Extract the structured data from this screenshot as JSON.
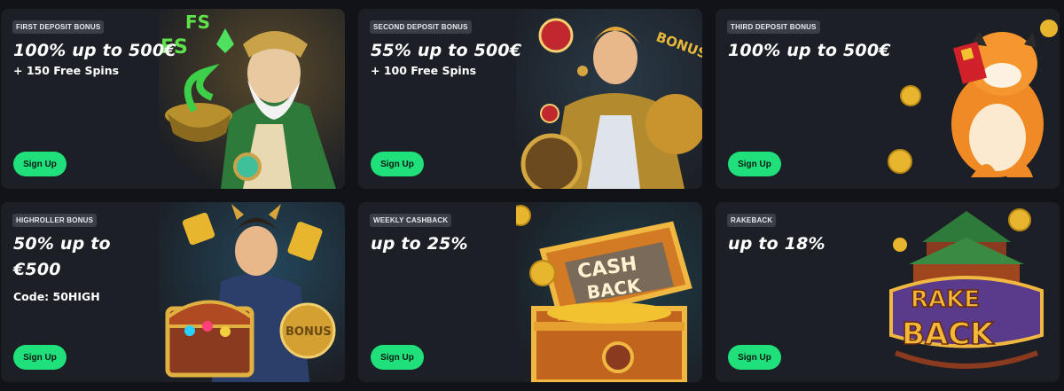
{
  "sign_up_label": "Sign Up",
  "accent_color": "#1fe07a",
  "cards": [
    {
      "badge": "FIRST DEPOSIT BONUS",
      "headline": "100% up to 500€",
      "sub": "+ 150 Free Spins",
      "art_text": "FS",
      "art_icon": "sage-warrior-illustration"
    },
    {
      "badge": "SECOND DEPOSIT BONUS",
      "headline": "55% up to 500€",
      "sub": "+ 100 Free Spins",
      "art_text": "BONUS",
      "art_icon": "golden-knight-illustration"
    },
    {
      "badge": "THIRD DEPOSIT BONUS",
      "headline": "100% up to 500€",
      "art_icon": "tiger-mascot-illustration"
    },
    {
      "badge": "HIGHROLLER BONUS",
      "headline_line1": "50% up to",
      "headline_line2": "€500",
      "sub": "Code: 50HIGH",
      "art_text": "BONUS",
      "art_icon": "treasure-warrior-illustration"
    },
    {
      "badge": "WEEKLY CASHBACK",
      "headline": "up to 25%",
      "art_text_1": "CASH",
      "art_text_2": "BACK",
      "art_icon": "cashback-chest-illustration"
    },
    {
      "badge": "RAKEBACK",
      "headline": "up to 18%",
      "art_text_1": "RAKE",
      "art_text_2": "BACK",
      "art_icon": "rakeback-temple-illustration"
    }
  ]
}
